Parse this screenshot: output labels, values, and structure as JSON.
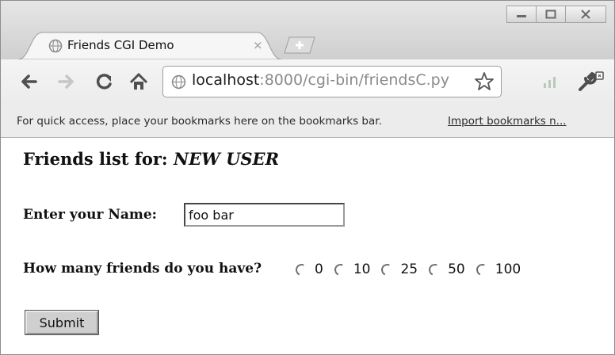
{
  "browser": {
    "tab": {
      "title": "Friends CGI Demo",
      "close": "×"
    },
    "window_controls": {
      "minimize": "–",
      "maximize": "▢",
      "close": "X"
    },
    "address": {
      "host": "localhost",
      "path": ":8000/cgi-bin/friendsC.py"
    },
    "bookmarks_bar": {
      "text": "For quick access, place your bookmarks here on the bookmarks bar.",
      "link": "Import bookmarks n..."
    }
  },
  "page": {
    "heading_prefix": "Friends list for: ",
    "heading_user": "NEW USER",
    "name_label": "Enter your Name:",
    "name_value": "foo bar",
    "friends_label": "How many friends do you have?",
    "friend_options": [
      "0",
      "10",
      "25",
      "50",
      "100"
    ],
    "submit_label": "Submit"
  },
  "colors": {
    "accent": "#4a4a4a",
    "link": "#2a2a2a"
  }
}
